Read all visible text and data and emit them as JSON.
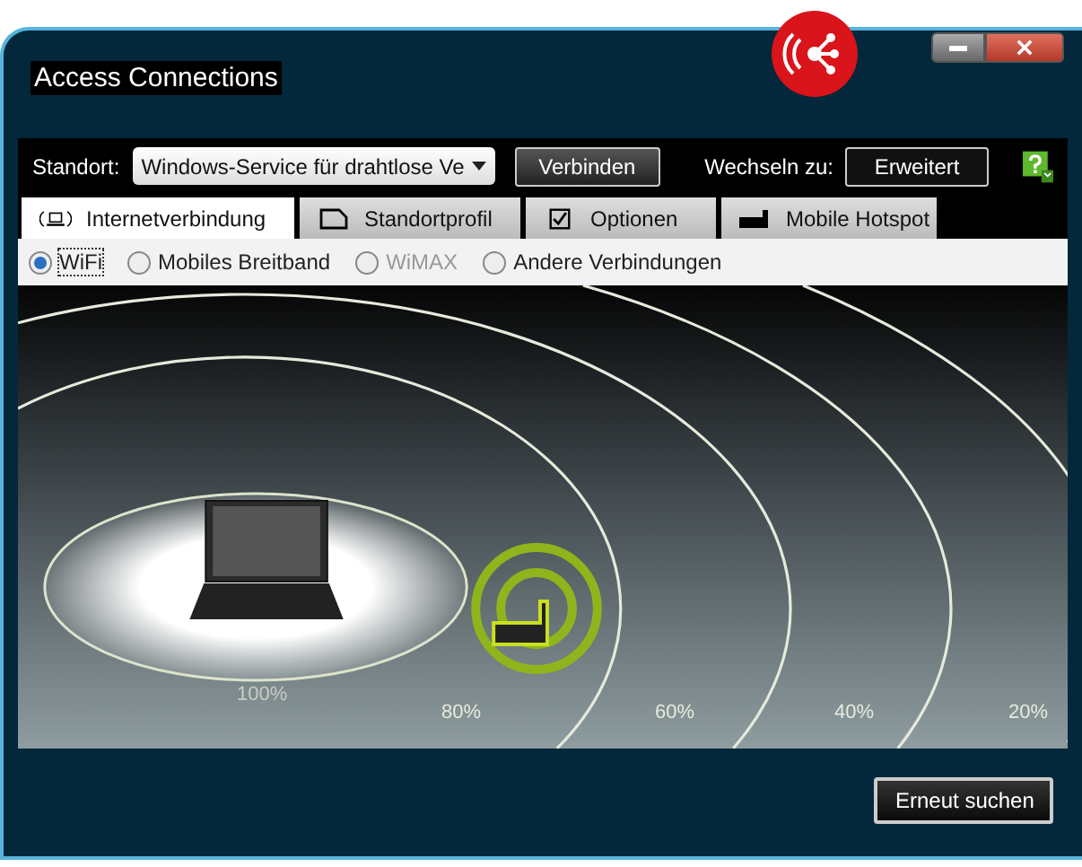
{
  "window": {
    "title": "Access Connections"
  },
  "toolbar": {
    "location_label": "Standort:",
    "location_value": "Windows-Service für drahtlose Ve",
    "connect_button": "Verbinden",
    "switch_label": "Wechseln zu:",
    "switch_button": "Erweitert"
  },
  "tabs": [
    {
      "label": "Internetverbindung",
      "selected": true
    },
    {
      "label": "Standortprofil",
      "selected": false
    },
    {
      "label": "Optionen",
      "selected": false
    },
    {
      "label": "Mobile Hotspot",
      "selected": false
    }
  ],
  "connection_types": [
    {
      "label": "WiFi",
      "selected": true,
      "disabled": false
    },
    {
      "label": "Mobiles Breitband",
      "selected": false,
      "disabled": false
    },
    {
      "label": "WiMAX",
      "selected": false,
      "disabled": true
    },
    {
      "label": "Andere Verbindungen",
      "selected": false,
      "disabled": false
    }
  ],
  "map": {
    "ring_labels": [
      "100%",
      "80%",
      "60%",
      "40%",
      "20%"
    ]
  },
  "buttons": [
    "Erneut suchen"
  ]
}
